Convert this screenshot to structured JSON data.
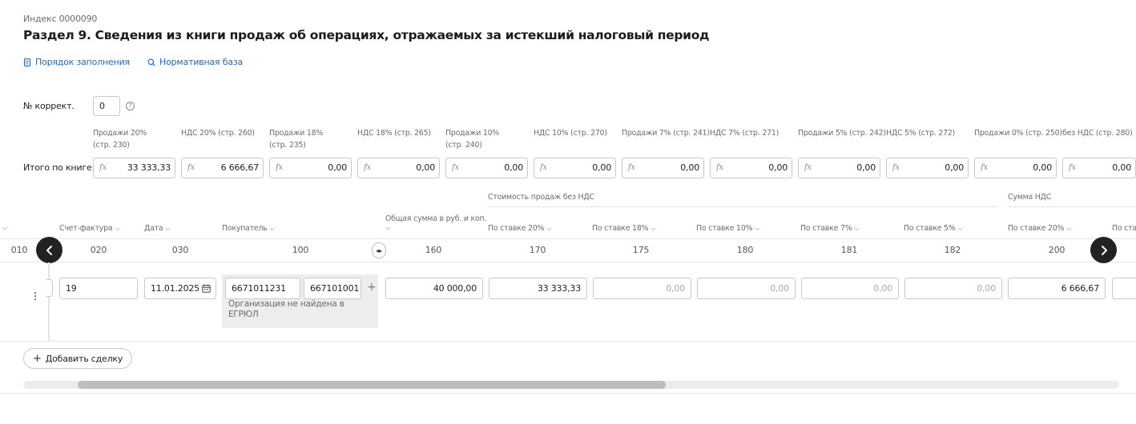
{
  "form": {
    "index": "Индекс 0000090",
    "title": "Раздел 9. Сведения из книги продаж об операциях, отражаемых за истекший налоговый период"
  },
  "links": {
    "fill_order": "Порядок заполнения",
    "normative": "Нормативная база"
  },
  "correction": {
    "label": "№ коррект.",
    "value": "0",
    "help": "?"
  },
  "totals": {
    "label": "Итого по книге",
    "fx": "fx",
    "columns": [
      {
        "line1": "Продажи 20%",
        "line2": "(стр. 230)",
        "value": "33 333,33"
      },
      {
        "line1": "НДС 20% (стр. 260)",
        "line2": "",
        "value": "6 666,67"
      },
      {
        "line1": "Продажи 18%",
        "line2": "(стр. 235)",
        "value": "0,00"
      },
      {
        "line1": "НДС 18% (стр. 265)",
        "line2": "",
        "value": "0,00"
      },
      {
        "line1": "Продажи 10%",
        "line2": "(стр. 240)",
        "value": "0,00"
      },
      {
        "line1": "НДС 10% (стр. 270)",
        "line2": "",
        "value": "0,00"
      },
      {
        "line1": "Продажи 7% (стр. 241)",
        "line2": "",
        "value": "0,00"
      },
      {
        "line1": "НДС 7% (стр. 271)",
        "line2": "",
        "value": "0,00"
      },
      {
        "line1": "Продажи 5% (стр. 242)",
        "line2": "",
        "value": "0,00"
      },
      {
        "line1": "НДС 5% (стр. 272)",
        "line2": "",
        "value": "0,00"
      },
      {
        "line1": "Продажи 0% (стр. 250)",
        "line2": "",
        "value": "0,00"
      },
      {
        "line1": "без НДС (стр. 280)",
        "line2": "",
        "value": "0,00"
      }
    ]
  },
  "table": {
    "groups": {
      "cost_without_vat": "Стоимость продаж без НДС",
      "vat_sum": "Сумма НДС"
    },
    "headers": {
      "cut_left": "",
      "invoice": "Счет-фактура",
      "date": "Дата",
      "buyer": "Покупатель",
      "total": "Общая сумма в руб. и коп.",
      "rate20": "По ставке 20%",
      "rate18": "По ставке 18%",
      "rate10": "По ставке 10%",
      "rate7": "По ставке 7%",
      "rate5": "По ставке 5%",
      "vat20": "По ставке 20%",
      "cut_right": "По ста"
    },
    "codes": {
      "c010": "010",
      "c020": "020",
      "c030": "030",
      "c100": "100",
      "c160": "160",
      "c170": "170",
      "c175": "175",
      "c180": "180",
      "c181": "181",
      "c182": "182",
      "c200": "200"
    },
    "row": {
      "invoice": "19",
      "date": "11.01.2025",
      "inn": "6671011231",
      "kpp": "667101001",
      "buyer_note": "Организация не найдена в ЕГРЮЛ",
      "total": "40 000,00",
      "rate20": "33 333,33",
      "rate18": "0,00",
      "rate10": "0,00",
      "rate7": "0,00",
      "rate5": "0,00",
      "vat20": "6 666,67"
    }
  },
  "actions": {
    "add_deal": "Добавить сделку"
  },
  "icons": {
    "fill_order": "document-icon",
    "normative": "search-icon",
    "help": "question-circle-icon",
    "prev": "chevron-left-icon",
    "next": "chevron-right-icon",
    "calendar": "calendar-icon",
    "row_menu": "more-vertical-icon",
    "resize": "column-resize-icon"
  },
  "colors": {
    "link": "#1a66d6",
    "nav_button": "#222222",
    "scroll_thumb": "#bdbdbd"
  }
}
